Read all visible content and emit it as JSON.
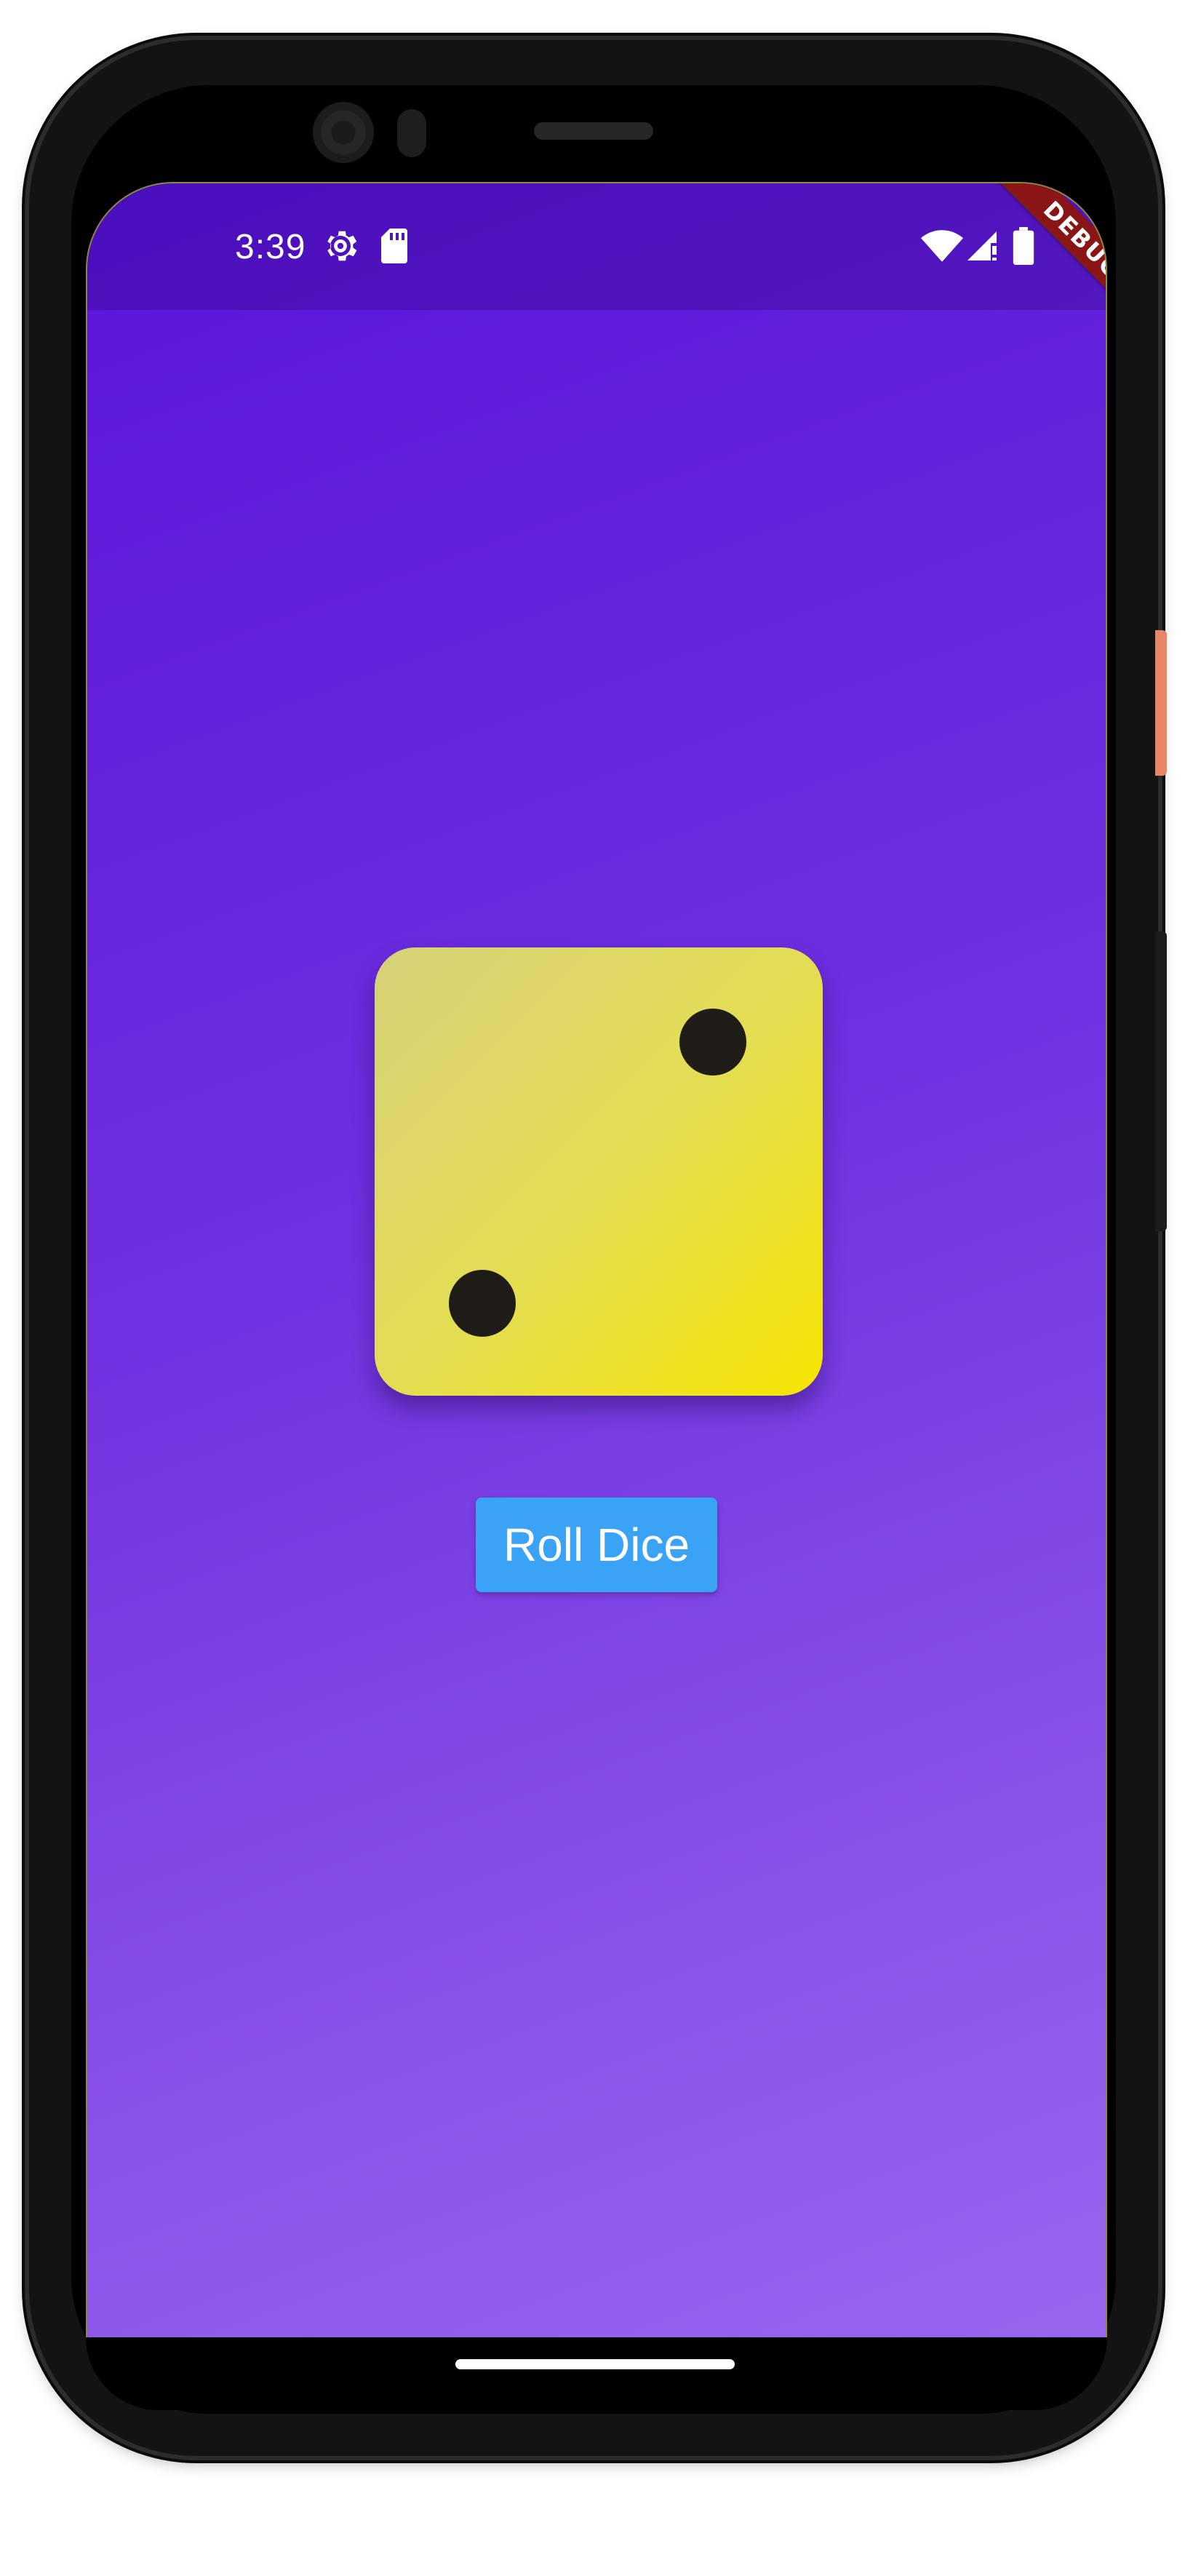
{
  "status_bar": {
    "time": "3:39",
    "icons": [
      "gear-icon",
      "sd-card-icon",
      "wifi-icon",
      "signal-icon",
      "battery-icon"
    ]
  },
  "debug_banner": {
    "label": "DEBUG",
    "color": "#8a1515"
  },
  "dice": {
    "value": 2,
    "face_colors": [
      "#d6d178",
      "#f6e400"
    ],
    "pip_color": "#1f1c17"
  },
  "roll_button": {
    "label": "Roll Dice",
    "color": "#3aa3f5"
  },
  "theme": {
    "background_gradient": [
      "#5a14d8",
      "#9865ee"
    ]
  }
}
